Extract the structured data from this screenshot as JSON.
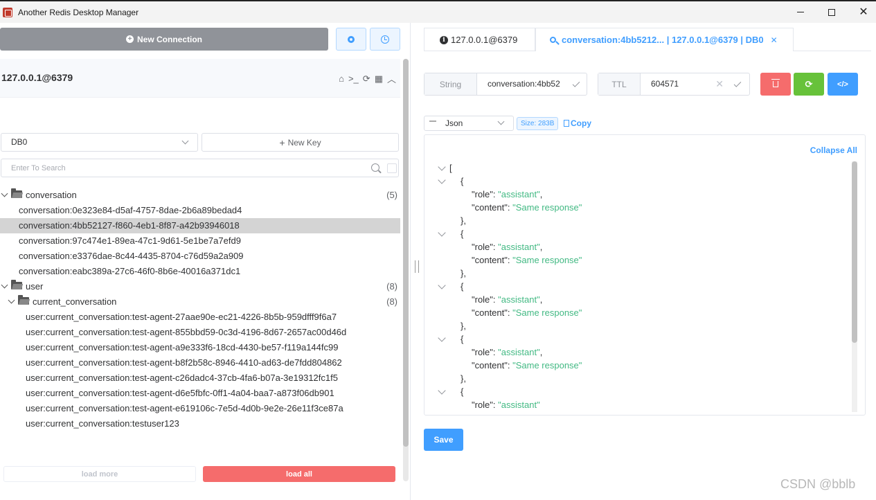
{
  "window": {
    "title": "Another Redis Desktop Manager"
  },
  "sidebar": {
    "new_connection_label": "New Connection",
    "connection_name": "127.0.0.1@6379",
    "db_select_value": "DB0",
    "new_key_label": "New Key",
    "search_placeholder": "Enter To Search",
    "tree": [
      {
        "type": "folder",
        "level": 0,
        "label": "conversation",
        "count": "(5)"
      },
      {
        "type": "key",
        "level": 0,
        "label": "conversation:0e323e84-d5af-4757-8dae-2b6a89bedad4"
      },
      {
        "type": "key",
        "level": 0,
        "label": "conversation:4bb52127-f860-4eb1-8f87-a42b93946018",
        "selected": true
      },
      {
        "type": "key",
        "level": 0,
        "label": "conversation:97c474e1-89ea-47c1-9d61-5e1be7a7efd9"
      },
      {
        "type": "key",
        "level": 0,
        "label": "conversation:e3376dae-8c44-4435-8704-c76d59a2a909"
      },
      {
        "type": "key",
        "level": 0,
        "label": "conversation:eabc389a-27c6-46f0-8b6e-40016a371dc1"
      },
      {
        "type": "folder",
        "level": 0,
        "label": "user",
        "count": "(8)"
      },
      {
        "type": "folder",
        "level": 1,
        "label": "current_conversation",
        "count": "(8)"
      },
      {
        "type": "key",
        "level": 1,
        "label": "user:current_conversation:test-agent-27aae90e-ec21-4226-8b5b-959dfff9f6a7"
      },
      {
        "type": "key",
        "level": 1,
        "label": "user:current_conversation:test-agent-855bbd59-0c3d-4196-8d67-2657ac00d46d"
      },
      {
        "type": "key",
        "level": 1,
        "label": "user:current_conversation:test-agent-a9e333f6-18cd-4430-be57-f119a144fc99"
      },
      {
        "type": "key",
        "level": 1,
        "label": "user:current_conversation:test-agent-b8f2b58c-8946-4410-ad63-de7fdd804862"
      },
      {
        "type": "key",
        "level": 1,
        "label": "user:current_conversation:test-agent-c26dadc4-37cb-4fa6-b07a-3e19312fc1f5"
      },
      {
        "type": "key",
        "level": 1,
        "label": "user:current_conversation:test-agent-d6e5fbfc-0ff1-4a04-baa7-a873f06db901"
      },
      {
        "type": "key",
        "level": 1,
        "label": "user:current_conversation:test-agent-e619106c-7e5d-4d0b-9e2e-26e11f3ce87a"
      },
      {
        "type": "key",
        "level": 1,
        "label": "user:current_conversation:testuser123"
      }
    ],
    "load_more_label": "load more",
    "load_all_label": "load all"
  },
  "tabs": [
    {
      "label": "127.0.0.1@6379",
      "icon": "info-icon"
    },
    {
      "label": "conversation:4bb5212... | 127.0.0.1@6379 | DB0",
      "icon": "key-icon",
      "active": true
    }
  ],
  "key_detail": {
    "type_label": "String",
    "key_name": "conversation:4bb52",
    "ttl_label": "TTL",
    "ttl_value": "604571",
    "format_value": "Json",
    "size_badge": "Size: 283B",
    "copy_label": "Copy",
    "collapse_all_label": "Collapse All",
    "save_label": "Save"
  },
  "json_view": {
    "open_bracket": "[",
    "items": [
      {
        "role": "assistant",
        "content": "Same response"
      },
      {
        "role": "assistant",
        "content": "Same response"
      },
      {
        "role": "assistant",
        "content": "Same response"
      },
      {
        "role": "assistant",
        "content": "Same response"
      },
      {
        "role": "assistant"
      }
    ]
  },
  "watermark": "CSDN @bblb",
  "colors": {
    "primary": "#409eff",
    "danger": "#f56c6c",
    "success": "#67c23a",
    "string_value": "#42b983"
  }
}
